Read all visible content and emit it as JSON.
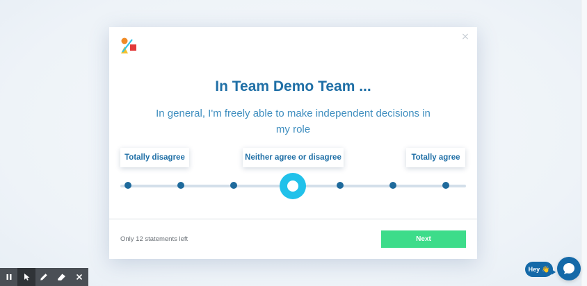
{
  "survey": {
    "title": "In Team Demo Team ...",
    "statement": "In general, I'm freely able to make independent decisions in my role",
    "scale": {
      "labels": {
        "left": "Totally disagree",
        "middle": "Neither agree or disagree",
        "right": "Totally agree"
      },
      "points": 7,
      "selected_point": 4
    },
    "remaining_text": "Only 12 statements left",
    "next_label": "Next",
    "close_symbol": "×"
  },
  "chat": {
    "greeting": "Hey",
    "greeting_icon": "waving-hand-icon",
    "launcher_icon": "chat-bubble-icon"
  },
  "toolbar": {
    "tools": [
      "pause-icon",
      "pointer-icon",
      "pen-icon",
      "eraser-icon",
      "close-icon"
    ],
    "active_tool": "pointer-icon"
  },
  "colors": {
    "title": "#1f6fa6",
    "accent_selected": "#21c1ea",
    "dot": "#1e6a9c",
    "next_button": "#3ddc8a",
    "chat": "#1469a8"
  }
}
